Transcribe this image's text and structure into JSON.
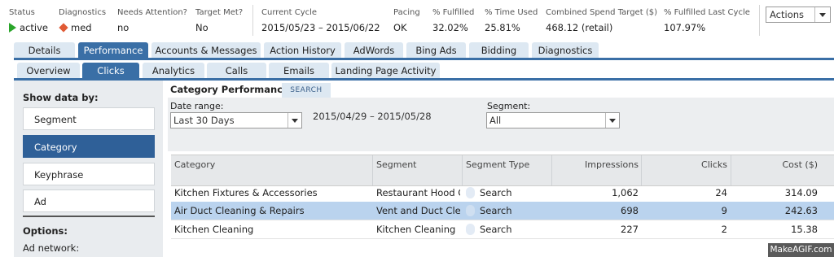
{
  "status_bar": {
    "status": {
      "label": "Status",
      "value": "active"
    },
    "diagnostics": {
      "label": "Diagnostics",
      "value": "med"
    },
    "needs_attention": {
      "label": "Needs Attention?",
      "value": "no"
    },
    "target_met": {
      "label": "Target Met?",
      "value": "No"
    },
    "current_cycle": {
      "label": "Current Cycle",
      "value": "2015/05/23 – 2015/06/22"
    },
    "pacing": {
      "label": "Pacing",
      "value": "OK"
    },
    "pct_fulfilled": {
      "label": "% Fulfilled",
      "value": "32.02%"
    },
    "pct_time_used": {
      "label": "% Time Used",
      "value": "25.81%"
    },
    "combined_spend": {
      "label": "Combined Spend Target ($)",
      "value": "468.12 (retail)"
    },
    "pct_fulfilled_last": {
      "label": "% Fulfilled Last Cycle",
      "value": "107.97%"
    },
    "actions": {
      "value": "Actions"
    }
  },
  "colors": {
    "accent": "#3a6fa6",
    "active_status": "#2aa52a",
    "diagnostic_med": "#e05a35",
    "selected_row": "#bad3ee"
  },
  "main_tabs": [
    "Details",
    "Performance",
    "Accounts & Messages",
    "Action History",
    "AdWords",
    "Bing Ads",
    "Bidding",
    "Diagnostics"
  ],
  "main_tab_active": "Performance",
  "sub_tabs": [
    "Overview",
    "Clicks",
    "Analytics",
    "Calls",
    "Emails",
    "Landing Page Activity"
  ],
  "sub_tab_active": "Clicks",
  "left_panel": {
    "title": "Show data by:",
    "items": [
      "Segment",
      "Category",
      "Keyphrase",
      "Ad"
    ],
    "active": "Category",
    "options_title": "Options:",
    "ad_network_label": "Ad network:"
  },
  "main": {
    "title": "Category Performance",
    "search_label": "SEARCH",
    "date_range_label": "Date range:",
    "date_range_value": "Last 30 Days",
    "date_text": "2015/04/29 – 2015/05/28",
    "segment_label": "Segment:",
    "segment_value": "All"
  },
  "table": {
    "columns": [
      "Category",
      "Segment",
      "Segment Type",
      "Impressions",
      "Clicks",
      "Cost ($)"
    ],
    "rows": [
      {
        "category": "Kitchen Fixtures & Accessories",
        "segment": "Restaurant Hood Cl",
        "segment_type": "Search",
        "impressions": "1,062",
        "clicks": "24",
        "cost": "314.09"
      },
      {
        "category": "Air Duct Cleaning & Repairs",
        "segment": "Vent and Duct Clea",
        "segment_type": "Search",
        "impressions": "698",
        "clicks": "9",
        "cost": "242.63"
      },
      {
        "category": "Kitchen Cleaning",
        "segment": "Kitchen Cleaning",
        "segment_type": "Search",
        "impressions": "227",
        "clicks": "2",
        "cost": "15.38"
      }
    ]
  },
  "watermark": "MakeAGIF.com"
}
